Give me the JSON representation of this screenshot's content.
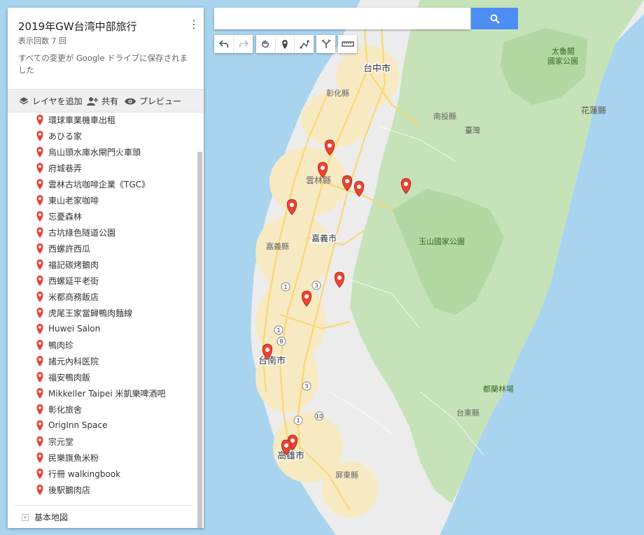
{
  "panel": {
    "title": "2019年GW台湾中部旅行",
    "views": "表示回数 7 回",
    "saved": "すべての変更が Google ドライブに保存されました",
    "add_layer": "レイヤを追加",
    "share": "共有",
    "preview": "プレビュー",
    "base_map": "基本地図",
    "items": [
      "環球車業機車出租",
      "あひる家",
      "烏山頭水庫水閘門火車頭",
      "府城巷弄",
      "雲林古坑咖啡企業《TGC》",
      "東山老家咖啡",
      "忘憂森林",
      "古坑綠色隧道公園",
      "西螺許西瓜",
      "福記碳烤鵝肉",
      "西螺延平老街",
      "米都商務飯店",
      "虎尾王家當歸鴨肉麵線",
      "Huwei Salon",
      "鴨肉珍",
      "諸元內科医院",
      "福安鴨肉飯",
      "Mikkeller Taipei 米凱樂啤酒吧",
      "彰化旅舍",
      "OrigInn Space",
      "宗元堂",
      "民樂旗魚米粉",
      "行冊 walkingbook",
      "後駅鵝肉店"
    ]
  },
  "search": {
    "value": ""
  },
  "map": {
    "labels": {
      "taichung": "台中市",
      "changhua": "彰化縣",
      "nantou": "南投縣",
      "taiwan": "臺灣",
      "taroko": "太魯閣\n國家公園",
      "hualien": "花蓮縣",
      "yunlin": "雲林縣",
      "chiayi_county": "嘉義縣",
      "chiayi_city": "嘉義市",
      "yushan": "玉山國家公園",
      "tainan": "台南市",
      "kaohsiung": "高雄市",
      "pingtung": "屏東縣",
      "taitung": "台東縣",
      "dulan": "都蘭林場"
    },
    "highways": [
      "1",
      "1",
      "8",
      "3",
      "10",
      "1",
      "3"
    ],
    "colors": {
      "sea": "#a9d4ef",
      "land": "#ececec",
      "forest": "#c5e2b8",
      "park": "#b2d7a2",
      "city": "#f7e9c2",
      "road": "#fbd772",
      "pin": "#ea4335"
    }
  }
}
